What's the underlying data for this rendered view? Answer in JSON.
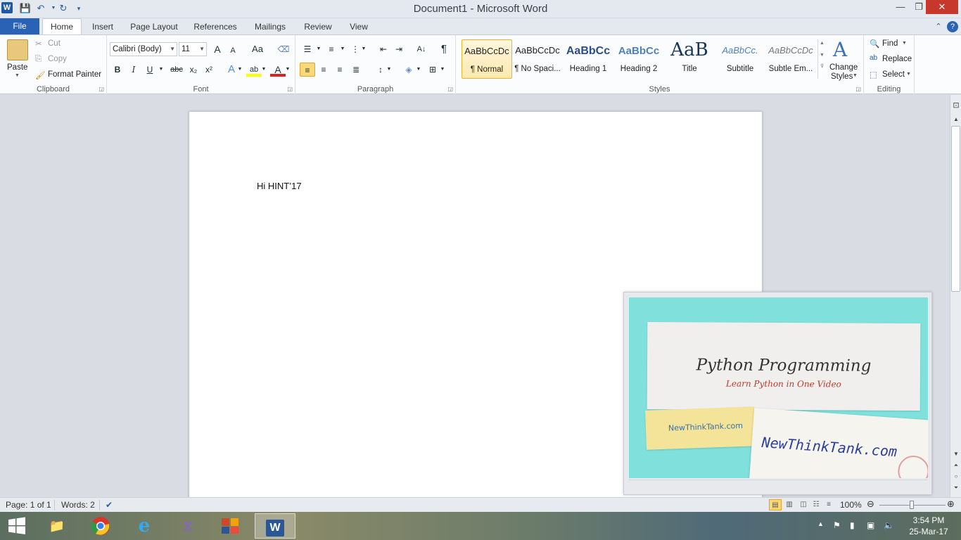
{
  "window": {
    "title": "Document1  -  Microsoft Word",
    "app_icon": "W",
    "controls": {
      "minimize": "—",
      "maximize": "❐",
      "close": "✕"
    }
  },
  "tabs": {
    "file": "File",
    "items": [
      "Home",
      "Insert",
      "Page Layout",
      "References",
      "Mailings",
      "Review",
      "View"
    ],
    "active": "Home"
  },
  "clipboard": {
    "paste": "Paste",
    "cut": "Cut",
    "copy": "Copy",
    "format_painter": "Format Painter",
    "label": "Clipboard"
  },
  "font": {
    "name": "Calibri (Body)",
    "size": "11",
    "grow": "A",
    "shrink": "A",
    "change_case": "Aa",
    "bold": "B",
    "italic": "I",
    "underline": "U",
    "strike": "abc",
    "subscript": "x₂",
    "superscript": "x²",
    "font_color_glyph": "A",
    "label": "Font"
  },
  "paragraph": {
    "show_marks": "¶",
    "label": "Paragraph"
  },
  "styles": {
    "items": [
      {
        "sample": "AaBbCcDc",
        "name": "¶ Normal"
      },
      {
        "sample": "AaBbCcDc",
        "name": "¶ No Spaci..."
      },
      {
        "sample": "AaBbCc",
        "name": "Heading 1"
      },
      {
        "sample": "AaBbCc",
        "name": "Heading 2"
      },
      {
        "sample": "AaB",
        "name": "Title"
      },
      {
        "sample": "AaBbCc.",
        "name": "Subtitle"
      },
      {
        "sample": "AaBbCcDc",
        "name": "Subtle Em..."
      }
    ],
    "change_styles": "Change",
    "change_styles_2": "Styles",
    "label": "Styles"
  },
  "editing": {
    "find": "Find",
    "replace": "Replace",
    "select": "Select",
    "label": "Editing"
  },
  "document": {
    "text": "Hi HINT’17"
  },
  "video": {
    "title": "Python Programming",
    "subtitle": "Learn Python in One Video",
    "tag": "NewThinkTank.com",
    "note": "NewThinkTank.com"
  },
  "status": {
    "page": "Page: 1 of 1",
    "words": "Words: 2",
    "zoom": "100%"
  },
  "taskbar": {
    "time": "3:54 PM",
    "date": "25-Mar-17"
  },
  "colors": {
    "file_tab": "#2a62b6",
    "close_button": "#c7372b",
    "active_style": "#fde9b0",
    "video_bg": "#7fe0dc"
  }
}
